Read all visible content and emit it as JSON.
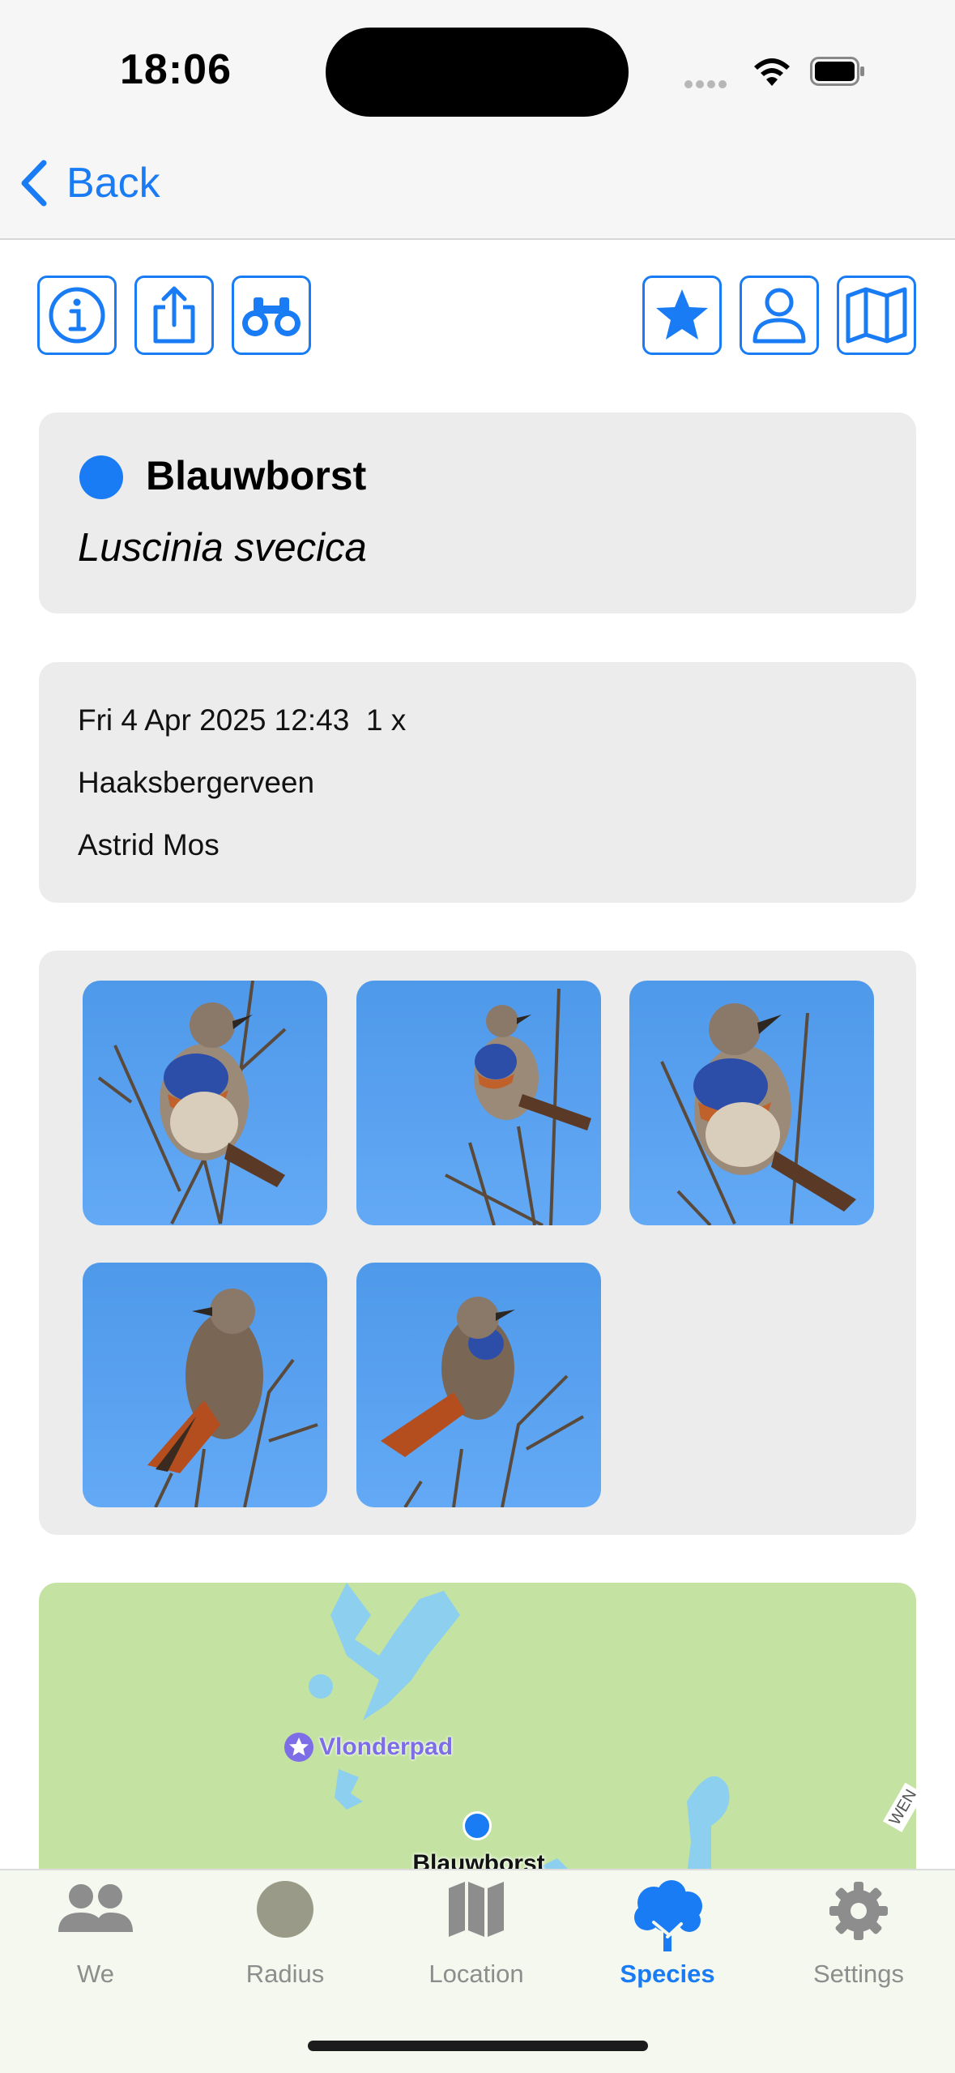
{
  "status_bar": {
    "time": "18:06"
  },
  "nav": {
    "back_label": "Back"
  },
  "toolbar": {
    "left_icons": [
      "info-icon",
      "share-icon",
      "binoculars-icon"
    ],
    "right_icons": [
      "star-icon",
      "person-icon",
      "map-icon"
    ]
  },
  "species": {
    "common_name": "Blauwborst",
    "scientific_name": "Luscinia svecica",
    "dot_color": "#1a7cf5"
  },
  "observation": {
    "datetime": "Fri 4 Apr 2025 12:43",
    "count": "1 x",
    "location": "Haaksbergerveen",
    "observer": "Astrid Mos"
  },
  "photos": [
    {
      "name": "bluethroat-photo-1"
    },
    {
      "name": "bluethroat-photo-2"
    },
    {
      "name": "bluethroat-photo-3"
    },
    {
      "name": "bluethroat-photo-4"
    },
    {
      "name": "bluethroat-photo-5"
    }
  ],
  "map": {
    "poi_label": "Vlonderpad",
    "marker_label": "Blauwborst",
    "edge_label": "WEN"
  },
  "tabs": [
    {
      "label": "We",
      "icon": "people-icon",
      "active": false
    },
    {
      "label": "Radius",
      "icon": "circle-icon",
      "active": false
    },
    {
      "label": "Location",
      "icon": "map-icon",
      "active": false
    },
    {
      "label": "Species",
      "icon": "tree-icon",
      "active": true
    },
    {
      "label": "Settings",
      "icon": "gear-icon",
      "active": false
    }
  ],
  "colors": {
    "accent": "#1a7cf5",
    "card": "#ececec",
    "map_land": "#c4e3a2",
    "map_water": "#8ccfee"
  }
}
